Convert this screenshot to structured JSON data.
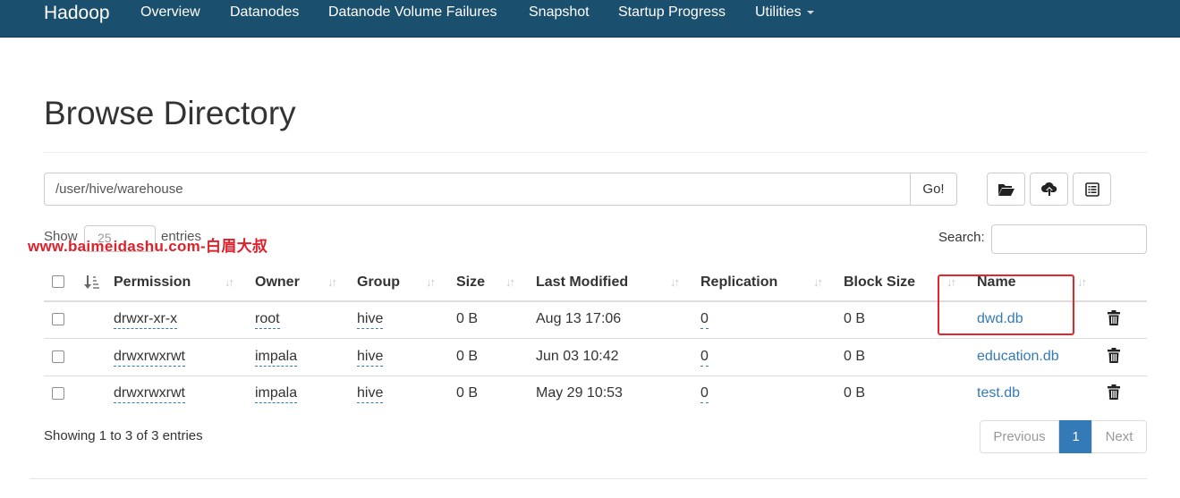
{
  "navbar": {
    "brand": "Hadoop",
    "items": [
      "Overview",
      "Datanodes",
      "Datanode Volume Failures",
      "Snapshot",
      "Startup Progress",
      "Utilities"
    ]
  },
  "page": {
    "title": "Browse Directory"
  },
  "path_bar": {
    "value": "/user/hive/warehouse",
    "go_label": "Go!"
  },
  "toolbar": {
    "icons": [
      "folder-open-icon",
      "upload-cloud-icon",
      "list-alt-icon"
    ]
  },
  "length_control": {
    "show_label": "Show",
    "selected": "25",
    "entries_label": "entries"
  },
  "watermark": "www.baimeidashu.com-白眉大叔",
  "search": {
    "label": "Search:",
    "value": ""
  },
  "table": {
    "columns": [
      "Permission",
      "Owner",
      "Group",
      "Size",
      "Last Modified",
      "Replication",
      "Block Size",
      "Name"
    ],
    "rows": [
      {
        "permission": "drwxr-xr-x",
        "owner": "root",
        "group": "hive",
        "size": "0 B",
        "last_modified": "Aug 13 17:06",
        "replication": "0",
        "block_size": "0 B",
        "name": "dwd.db"
      },
      {
        "permission": "drwxrwxrwt",
        "owner": "impala",
        "group": "hive",
        "size": "0 B",
        "last_modified": "Jun 03 10:42",
        "replication": "0",
        "block_size": "0 B",
        "name": "education.db"
      },
      {
        "permission": "drwxrwxrwt",
        "owner": "impala",
        "group": "hive",
        "size": "0 B",
        "last_modified": "May 29 10:53",
        "replication": "0",
        "block_size": "0 B",
        "name": "test.db"
      }
    ]
  },
  "footer": {
    "info": "Showing 1 to 3 of 3 entries"
  },
  "pagination": {
    "previous": "Previous",
    "current": "1",
    "next": "Next"
  },
  "colors": {
    "navbar": "#1b4f6e",
    "link": "#337ab7",
    "highlight": "#e6262d",
    "active_page": "#337ab7"
  }
}
